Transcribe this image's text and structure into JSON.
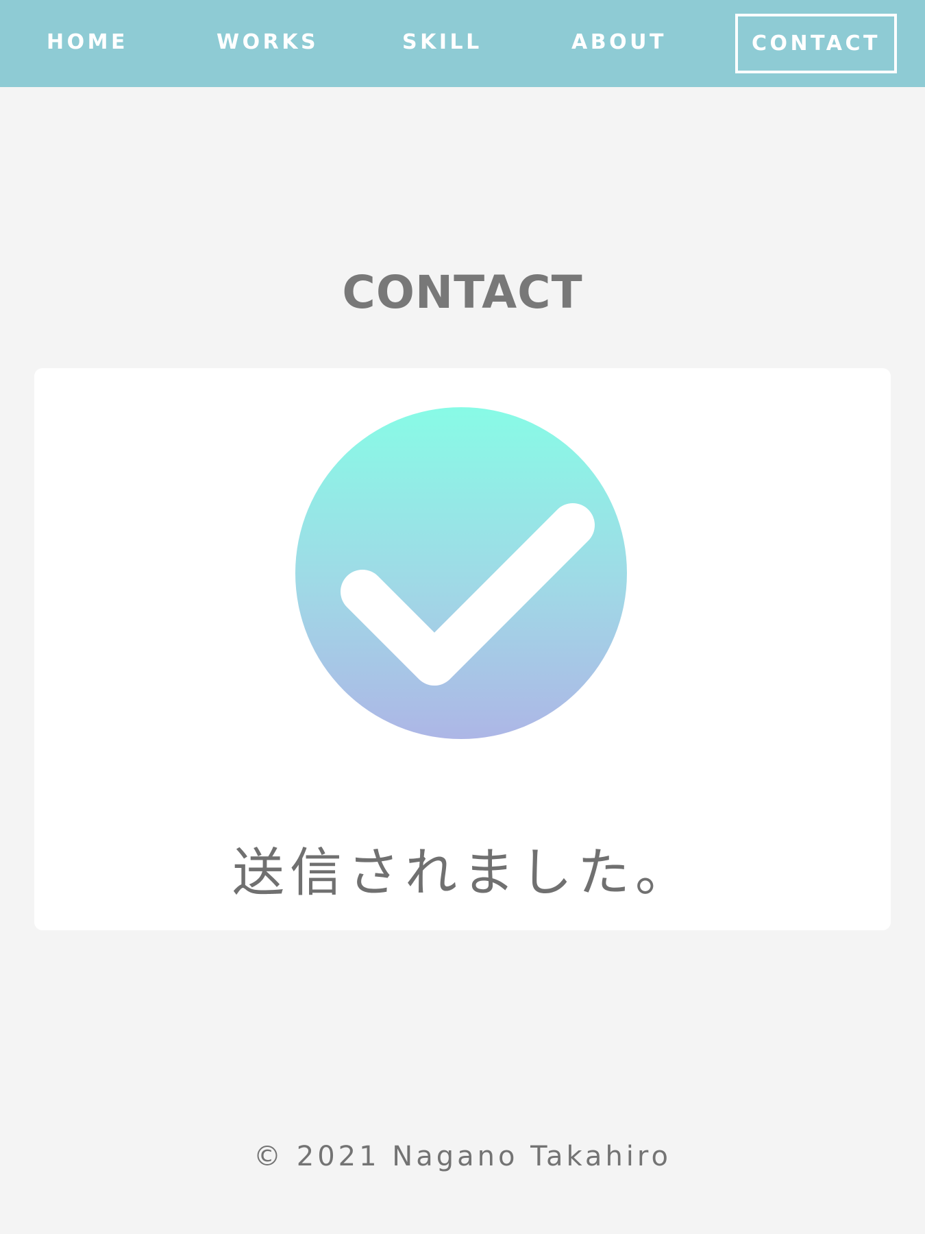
{
  "nav": {
    "items": [
      {
        "label": "HOME"
      },
      {
        "label": "WORKS"
      },
      {
        "label": "SKILL"
      },
      {
        "label": "ABOUT"
      },
      {
        "label": "CONTACT",
        "active": true
      }
    ],
    "background": "#8ecbd4"
  },
  "main": {
    "title": "contact",
    "success_message": "送信されました。",
    "check_icon": "check-circle-icon",
    "gradient_top": "#88fbe6",
    "gradient_bottom": "#adb6e6"
  },
  "footer": {
    "copyright": "© 2021 Nagano Takahiro"
  }
}
